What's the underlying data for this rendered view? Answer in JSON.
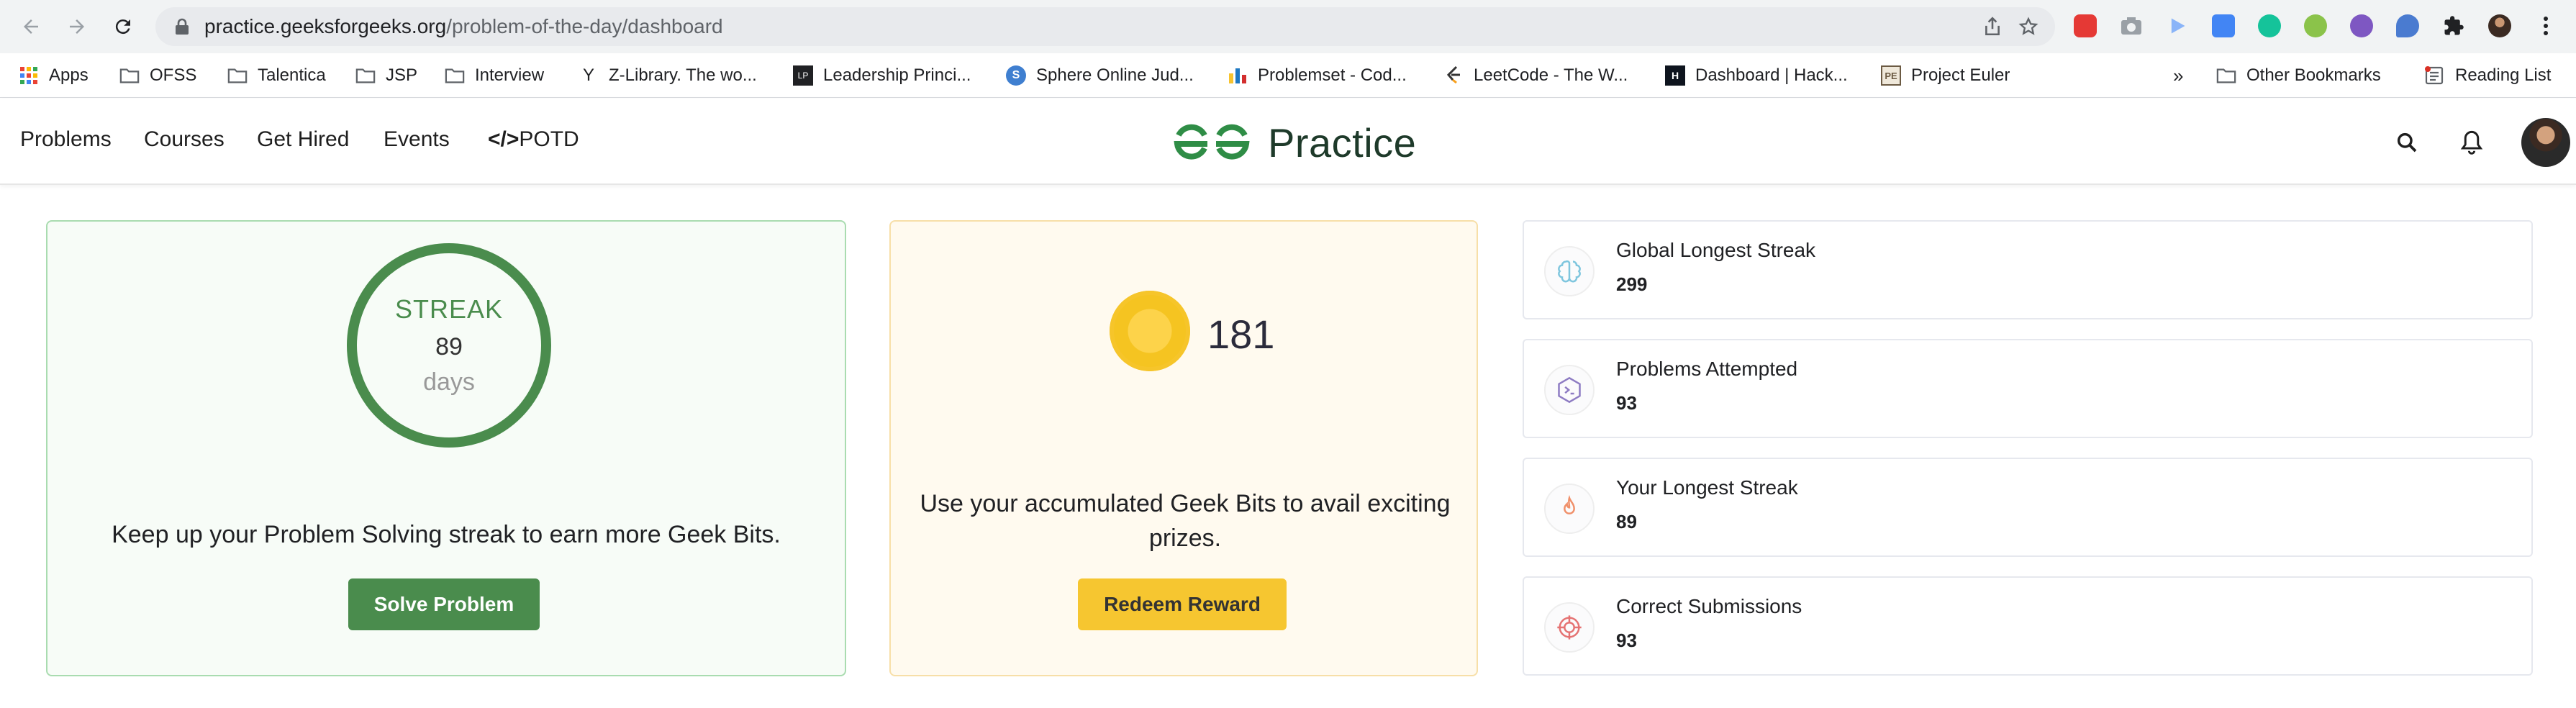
{
  "browser": {
    "url_host": "practice.geeksforgeeks.org",
    "url_path": "/problem-of-the-day/dashboard",
    "extensions": [
      {
        "name": "adblock-icon",
        "color": "#e53935"
      },
      {
        "name": "camera-icon",
        "color": "#5f6368"
      },
      {
        "name": "play-icon",
        "color": "#8ab4f8"
      },
      {
        "name": "translate-icon",
        "color": "#4285f4"
      },
      {
        "name": "grammarly-icon",
        "color": "#15c39a"
      },
      {
        "name": "plus-icon",
        "color": "#8bc34a"
      },
      {
        "name": "brain-icon",
        "color": "#7e57c2"
      },
      {
        "name": "chat-icon",
        "color": "#4a7bd0"
      }
    ],
    "bookmarks": [
      {
        "label": "Apps",
        "icon": "apps-grid-icon"
      },
      {
        "label": "OFSS",
        "icon": "folder-icon"
      },
      {
        "label": "Talentica",
        "icon": "folder-icon"
      },
      {
        "label": "JSP",
        "icon": "folder-icon"
      },
      {
        "label": "Interview",
        "icon": "folder-icon"
      },
      {
        "label": "Z-Library. The wo...",
        "icon": "zlibrary-icon"
      },
      {
        "label": "Leadership Princi...",
        "icon": "lp-icon"
      },
      {
        "label": "Sphere Online Jud...",
        "icon": "spoj-icon"
      },
      {
        "label": "Problemset - Cod...",
        "icon": "codeforces-icon"
      },
      {
        "label": "LeetCode - The W...",
        "icon": "leetcode-icon"
      },
      {
        "label": "Dashboard | Hack...",
        "icon": "hackerrank-icon"
      },
      {
        "label": "Project Euler",
        "icon": "euler-icon"
      }
    ],
    "overflow": "»",
    "other_bookmarks": "Other Bookmarks",
    "reading_list": "Reading List"
  },
  "header": {
    "nav": [
      "Problems",
      "Courses",
      "Get Hired",
      "Events"
    ],
    "potd_symbol": "</>",
    "potd": "POTD",
    "brand": "Practice",
    "brand_color": "#2f8d46"
  },
  "streak": {
    "label": "STREAK",
    "count": "89",
    "unit": "days",
    "message": "Keep up your Problem Solving streak to earn more Geek Bits.",
    "button": "Solve Problem",
    "accent": "#4a8c4d"
  },
  "geek_bits": {
    "count": "181",
    "message": "Use your accumulated Geek Bits to avail exciting prizes.",
    "button": "Redeem Reward",
    "accent": "#f6c630"
  },
  "stats": [
    {
      "label": "Global Longest Streak",
      "value": "299",
      "icon": "brain-icon"
    },
    {
      "label": "Problems Attempted",
      "value": "93",
      "icon": "terminal-icon"
    },
    {
      "label": "Your Longest Streak",
      "value": "89",
      "icon": "flame-icon"
    },
    {
      "label": "Correct Submissions",
      "value": "93",
      "icon": "target-icon"
    }
  ]
}
